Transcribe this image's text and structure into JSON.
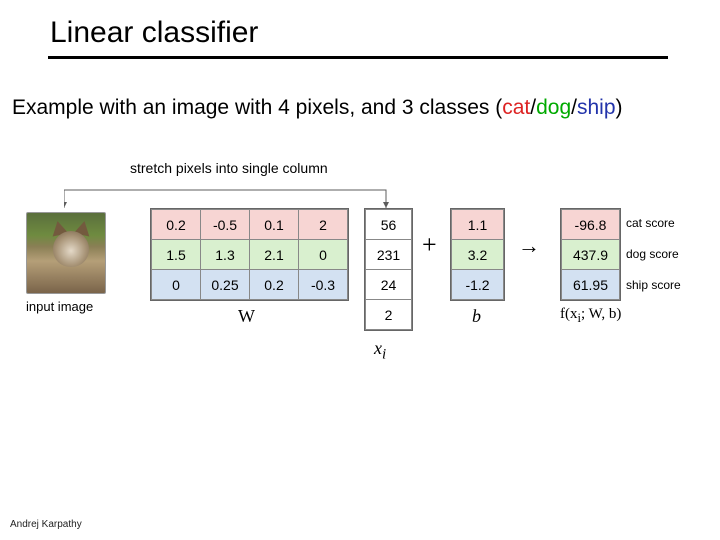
{
  "title": "Linear classifier",
  "example_prefix": "Example with an image with 4 pixels, and 3 classes (",
  "classes": {
    "cat": "cat",
    "dog": "dog",
    "ship": "ship"
  },
  "slash": "/",
  "paren_close": ")",
  "stretch_caption": "stretch pixels into single column",
  "input_image_label": "input image",
  "chart_data": {
    "type": "table",
    "W": [
      [
        0.2,
        -0.5,
        0.1,
        2.0
      ],
      [
        1.5,
        1.3,
        2.1,
        0.0
      ],
      [
        0,
        0.25,
        0.2,
        -0.3
      ]
    ],
    "x": [
      56,
      231,
      24,
      2
    ],
    "b": [
      1.1,
      3.2,
      -1.2
    ],
    "f": [
      -96.8,
      437.9,
      61.95
    ],
    "class_labels": [
      "cat score",
      "dog score",
      "ship score"
    ],
    "symbols": {
      "W": "W",
      "x": "x",
      "x_sub": "i",
      "b": "b",
      "f": "f(x",
      "f_sub": "i",
      "f_rest": "; W, b)",
      "plus": "+",
      "arrow": "→"
    },
    "row_colors": {
      "cat": "#f7d5d3",
      "dog": "#d9f0cf",
      "ship": "#d3e1f2"
    }
  },
  "credit": "Andrej Karpathy"
}
